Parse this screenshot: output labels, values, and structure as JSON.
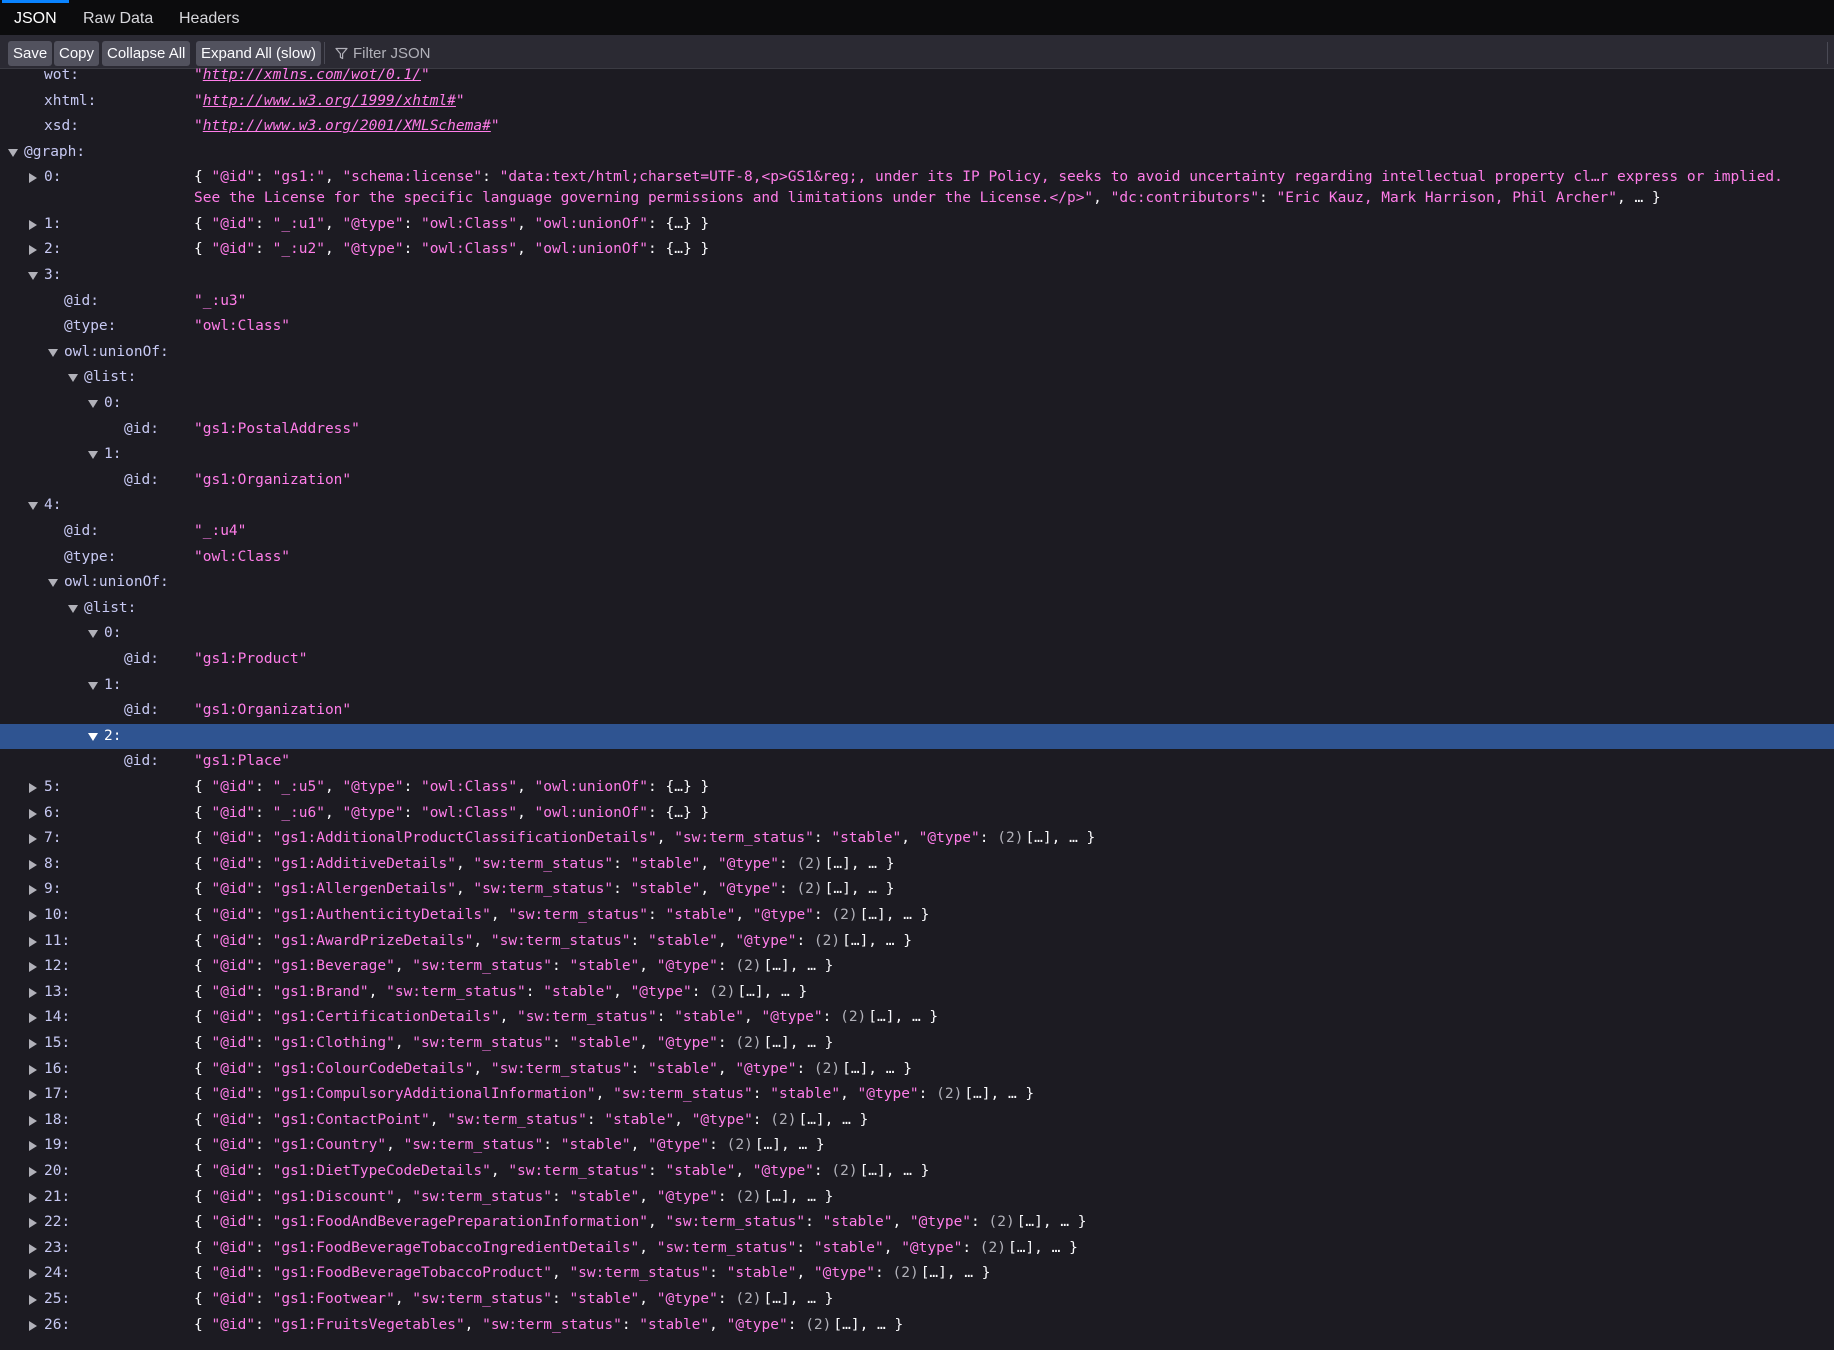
{
  "tabs": [
    {
      "label": "JSON",
      "active": true
    },
    {
      "label": "Raw Data",
      "active": false
    },
    {
      "label": "Headers",
      "active": false
    }
  ],
  "toolbar": {
    "save": "Save",
    "copy": "Copy",
    "collapse_all": "Collapse All",
    "expand_all": "Expand All (slow)",
    "filter_placeholder": "Filter JSON"
  },
  "colors": {
    "key": "#c7c9f3",
    "string": "#ff7de9",
    "punct": "#fbfbfe",
    "count": "#b1b1b9",
    "selected": "#2f5491",
    "background": "#1c1b22",
    "toolbar": "#2b2a33",
    "button": "#52525e",
    "active_tab": "#0a84ff"
  },
  "icons": {
    "expanded": "triangle-down-icon",
    "collapsed": "triangle-right-icon",
    "filter": "funnel-icon"
  },
  "tree": [
    {
      "depth": 1,
      "key": "wot:",
      "value": "http://xmlns.com/wot/0.1/",
      "kind": "link"
    },
    {
      "depth": 1,
      "key": "xhtml:",
      "value": "http://www.w3.org/1999/xhtml#",
      "kind": "link"
    },
    {
      "depth": 1,
      "key": "xsd:",
      "value": "http://www.w3.org/2001/XMLSchema#",
      "kind": "link"
    },
    {
      "depth": 0,
      "key": "@graph:",
      "toggle": "open"
    },
    {
      "depth": 1,
      "key": "0:",
      "toggle": "closed",
      "kind": "preview",
      "lines": 2,
      "parts": [
        {
          "t": "b",
          "s": "{ "
        },
        {
          "t": "q",
          "s": "\"@id\""
        },
        {
          "t": "b",
          "s": ": "
        },
        {
          "t": "q",
          "s": "\"gs1:\""
        },
        {
          "t": "b",
          "s": ", "
        },
        {
          "t": "q",
          "s": "\"schema:license\""
        },
        {
          "t": "b",
          "s": ": "
        },
        {
          "t": "q",
          "s": "\"data:text/html;charset=UTF-8,<p>GS1&reg;, under its IP Policy, seeks to avoid uncertainty regarding intellectual property cl…r express or implied. See the License for the specific language governing permissions and limitations under the License.</p>\""
        },
        {
          "t": "b",
          "s": ", "
        },
        {
          "t": "q",
          "s": "\"dc:contributors\""
        },
        {
          "t": "b",
          "s": ": "
        },
        {
          "t": "q",
          "s": "\"Eric Kauz, Mark Harrison, Phil Archer\""
        },
        {
          "t": "b",
          "s": ", … }"
        }
      ]
    },
    {
      "depth": 1,
      "key": "1:",
      "toggle": "closed",
      "kind": "preview",
      "parts": [
        {
          "t": "b",
          "s": "{ "
        },
        {
          "t": "q",
          "s": "\"@id\""
        },
        {
          "t": "b",
          "s": ": "
        },
        {
          "t": "q",
          "s": "\"_:u1\""
        },
        {
          "t": "b",
          "s": ", "
        },
        {
          "t": "q",
          "s": "\"@type\""
        },
        {
          "t": "b",
          "s": ": "
        },
        {
          "t": "q",
          "s": "\"owl:Class\""
        },
        {
          "t": "b",
          "s": ", "
        },
        {
          "t": "q",
          "s": "\"owl:unionOf\""
        },
        {
          "t": "b",
          "s": ": {…} }"
        }
      ]
    },
    {
      "depth": 1,
      "key": "2:",
      "toggle": "closed",
      "kind": "preview",
      "parts": [
        {
          "t": "b",
          "s": "{ "
        },
        {
          "t": "q",
          "s": "\"@id\""
        },
        {
          "t": "b",
          "s": ": "
        },
        {
          "t": "q",
          "s": "\"_:u2\""
        },
        {
          "t": "b",
          "s": ", "
        },
        {
          "t": "q",
          "s": "\"@type\""
        },
        {
          "t": "b",
          "s": ": "
        },
        {
          "t": "q",
          "s": "\"owl:Class\""
        },
        {
          "t": "b",
          "s": ", "
        },
        {
          "t": "q",
          "s": "\"owl:unionOf\""
        },
        {
          "t": "b",
          "s": ": {…} }"
        }
      ]
    },
    {
      "depth": 1,
      "key": "3:",
      "toggle": "open"
    },
    {
      "depth": 2,
      "key": "@id:",
      "value": "\"_:u3\"",
      "kind": "string"
    },
    {
      "depth": 2,
      "key": "@type:",
      "value": "\"owl:Class\"",
      "kind": "string"
    },
    {
      "depth": 2,
      "key": "owl:unionOf:",
      "toggle": "open"
    },
    {
      "depth": 3,
      "key": "@list:",
      "toggle": "open"
    },
    {
      "depth": 4,
      "key": "0:",
      "toggle": "open"
    },
    {
      "depth": 5,
      "key": "@id:",
      "value": "\"gs1:PostalAddress\"",
      "kind": "string"
    },
    {
      "depth": 4,
      "key": "1:",
      "toggle": "open"
    },
    {
      "depth": 5,
      "key": "@id:",
      "value": "\"gs1:Organization\"",
      "kind": "string"
    },
    {
      "depth": 1,
      "key": "4:",
      "toggle": "open"
    },
    {
      "depth": 2,
      "key": "@id:",
      "value": "\"_:u4\"",
      "kind": "string"
    },
    {
      "depth": 2,
      "key": "@type:",
      "value": "\"owl:Class\"",
      "kind": "string"
    },
    {
      "depth": 2,
      "key": "owl:unionOf:",
      "toggle": "open"
    },
    {
      "depth": 3,
      "key": "@list:",
      "toggle": "open"
    },
    {
      "depth": 4,
      "key": "0:",
      "toggle": "open"
    },
    {
      "depth": 5,
      "key": "@id:",
      "value": "\"gs1:Product\"",
      "kind": "string"
    },
    {
      "depth": 4,
      "key": "1:",
      "toggle": "open"
    },
    {
      "depth": 5,
      "key": "@id:",
      "value": "\"gs1:Organization\"",
      "kind": "string"
    },
    {
      "depth": 4,
      "key": "2:",
      "toggle": "open",
      "selected": true
    },
    {
      "depth": 5,
      "key": "@id:",
      "value": "\"gs1:Place\"",
      "kind": "string"
    },
    {
      "depth": 1,
      "key": "5:",
      "toggle": "closed",
      "kind": "preview",
      "parts": [
        {
          "t": "b",
          "s": "{ "
        },
        {
          "t": "q",
          "s": "\"@id\""
        },
        {
          "t": "b",
          "s": ": "
        },
        {
          "t": "q",
          "s": "\"_:u5\""
        },
        {
          "t": "b",
          "s": ", "
        },
        {
          "t": "q",
          "s": "\"@type\""
        },
        {
          "t": "b",
          "s": ": "
        },
        {
          "t": "q",
          "s": "\"owl:Class\""
        },
        {
          "t": "b",
          "s": ", "
        },
        {
          "t": "q",
          "s": "\"owl:unionOf\""
        },
        {
          "t": "b",
          "s": ": {…} }"
        }
      ]
    },
    {
      "depth": 1,
      "key": "6:",
      "toggle": "closed",
      "kind": "preview",
      "parts": [
        {
          "t": "b",
          "s": "{ "
        },
        {
          "t": "q",
          "s": "\"@id\""
        },
        {
          "t": "b",
          "s": ": "
        },
        {
          "t": "q",
          "s": "\"_:u6\""
        },
        {
          "t": "b",
          "s": ", "
        },
        {
          "t": "q",
          "s": "\"@type\""
        },
        {
          "t": "b",
          "s": ": "
        },
        {
          "t": "q",
          "s": "\"owl:Class\""
        },
        {
          "t": "b",
          "s": ", "
        },
        {
          "t": "q",
          "s": "\"owl:unionOf\""
        },
        {
          "t": "b",
          "s": ": {…} }"
        }
      ]
    },
    {
      "depth": 1,
      "key": "7:",
      "toggle": "closed",
      "kind": "term",
      "id": "gs1:AdditionalProductClassificationDetails"
    },
    {
      "depth": 1,
      "key": "8:",
      "toggle": "closed",
      "kind": "term",
      "id": "gs1:AdditiveDetails"
    },
    {
      "depth": 1,
      "key": "9:",
      "toggle": "closed",
      "kind": "term",
      "id": "gs1:AllergenDetails"
    },
    {
      "depth": 1,
      "key": "10:",
      "toggle": "closed",
      "kind": "term",
      "id": "gs1:AuthenticityDetails"
    },
    {
      "depth": 1,
      "key": "11:",
      "toggle": "closed",
      "kind": "term",
      "id": "gs1:AwardPrizeDetails"
    },
    {
      "depth": 1,
      "key": "12:",
      "toggle": "closed",
      "kind": "term",
      "id": "gs1:Beverage"
    },
    {
      "depth": 1,
      "key": "13:",
      "toggle": "closed",
      "kind": "term",
      "id": "gs1:Brand"
    },
    {
      "depth": 1,
      "key": "14:",
      "toggle": "closed",
      "kind": "term",
      "id": "gs1:CertificationDetails"
    },
    {
      "depth": 1,
      "key": "15:",
      "toggle": "closed",
      "kind": "term",
      "id": "gs1:Clothing"
    },
    {
      "depth": 1,
      "key": "16:",
      "toggle": "closed",
      "kind": "term",
      "id": "gs1:ColourCodeDetails"
    },
    {
      "depth": 1,
      "key": "17:",
      "toggle": "closed",
      "kind": "term",
      "id": "gs1:CompulsoryAdditionalInformation"
    },
    {
      "depth": 1,
      "key": "18:",
      "toggle": "closed",
      "kind": "term",
      "id": "gs1:ContactPoint"
    },
    {
      "depth": 1,
      "key": "19:",
      "toggle": "closed",
      "kind": "term",
      "id": "gs1:Country"
    },
    {
      "depth": 1,
      "key": "20:",
      "toggle": "closed",
      "kind": "term",
      "id": "gs1:DietTypeCodeDetails"
    },
    {
      "depth": 1,
      "key": "21:",
      "toggle": "closed",
      "kind": "term",
      "id": "gs1:Discount"
    },
    {
      "depth": 1,
      "key": "22:",
      "toggle": "closed",
      "kind": "term",
      "id": "gs1:FoodAndBeveragePreparationInformation"
    },
    {
      "depth": 1,
      "key": "23:",
      "toggle": "closed",
      "kind": "term",
      "id": "gs1:FoodBeverageTobaccoIngredientDetails"
    },
    {
      "depth": 1,
      "key": "24:",
      "toggle": "closed",
      "kind": "term",
      "id": "gs1:FoodBeverageTobaccoProduct"
    },
    {
      "depth": 1,
      "key": "25:",
      "toggle": "closed",
      "kind": "term",
      "id": "gs1:Footwear"
    },
    {
      "depth": 1,
      "key": "26:",
      "toggle": "closed",
      "kind": "term",
      "id": "gs1:FruitsVegetables"
    }
  ],
  "term_template": {
    "open": "{ ",
    "id_key": "\"@id\"",
    "sep": ": ",
    "comma": ", ",
    "status_key": "\"sw:term_status\"",
    "status_val": "\"stable\"",
    "type_key": "\"@type\"",
    "count": "(2)",
    "tail": "[…], … }"
  }
}
